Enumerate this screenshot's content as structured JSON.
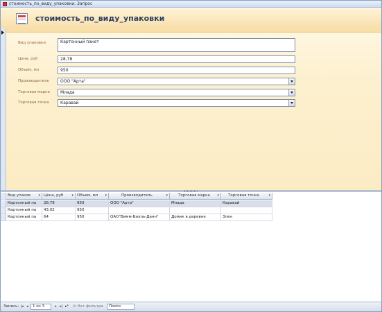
{
  "window": {
    "title": "стоимость_по_виду_упаковки: Запрос"
  },
  "form": {
    "title": "стоимость_по_виду_упаковки",
    "fields": [
      {
        "label": "Вид упаковки",
        "value": "Картонный пакет"
      },
      {
        "label": "Цена, руб",
        "value": "28,78"
      },
      {
        "label": "Объем, мл",
        "value": "950"
      },
      {
        "label": "Производитель",
        "value": "ООО \"Арта\""
      },
      {
        "label": "Торговая марка",
        "value": "Млада"
      },
      {
        "label": "Торговая точка",
        "value": "Каравай"
      }
    ]
  },
  "datasheet": {
    "columns": [
      "Вид упаков",
      "Цена, руб",
      "Объем, мл",
      "Производитель",
      "Торговая марка",
      "Торговая точка"
    ],
    "rows": [
      [
        "Картонный па",
        "28,78",
        "950",
        "ООО \"Арта\"",
        "Млада",
        "Каравай"
      ],
      [
        "Картонный па",
        "43,02",
        "950",
        "",
        "",
        ""
      ],
      [
        "Картонный па",
        "64",
        "950",
        "ОАО\"Вимм-Билль-Данн\"",
        "Домик в деревне",
        "Злен"
      ]
    ]
  },
  "statusbar": {
    "records_label": "Запись:",
    "position": "1 из 3",
    "filter_label": "Нет фильтра",
    "search_label": "Поиск"
  }
}
